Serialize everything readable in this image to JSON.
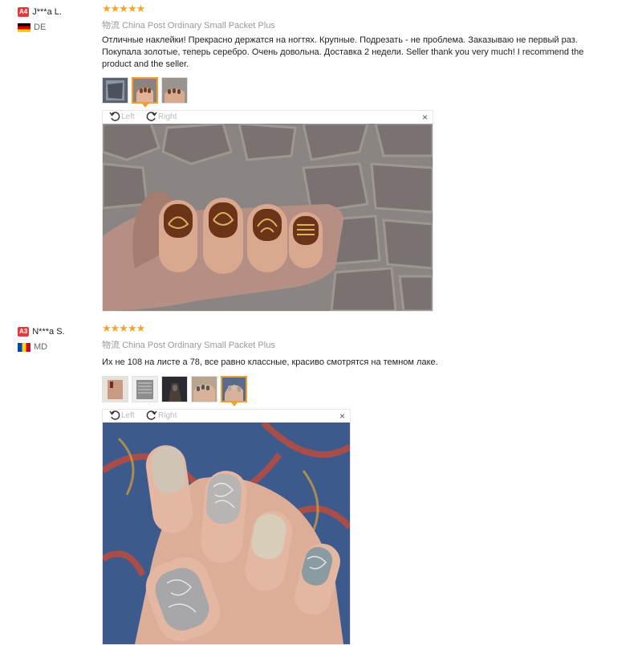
{
  "reviews": [
    {
      "level": "A4",
      "name": "J***a L.",
      "country": "DE",
      "stars": "★★★★★",
      "logistics_key": "物流",
      "logistics_value": "China Post Ordinary Small Packet Plus",
      "text": "Отличные наклейки! Прекрасно держатся на ногтях. Крупные. Подрезать - не проблема. Заказываю не первый раз. Покупала золотые, теперь серебро. Очень довольна. Доставка 2 недели. Seller thank you very much! I recommend the product and the seller.",
      "left_label": "Left",
      "right_label": "Right",
      "close": "×"
    },
    {
      "level": "A3",
      "name": "N***a S.",
      "country": "MD",
      "stars": "★★★★★",
      "logistics_key": "物流",
      "logistics_value": "China Post Ordinary Small Packet Plus",
      "text": "Их не 108 на листе а 78, все равно классные, красиво смотрятся на темном лаке.",
      "left_label": "Left",
      "right_label": "Right",
      "close": "×"
    }
  ],
  "colors": {
    "star": "#f5a623",
    "level_badge": "#e4393c",
    "active_thumb": "#f0a030"
  }
}
